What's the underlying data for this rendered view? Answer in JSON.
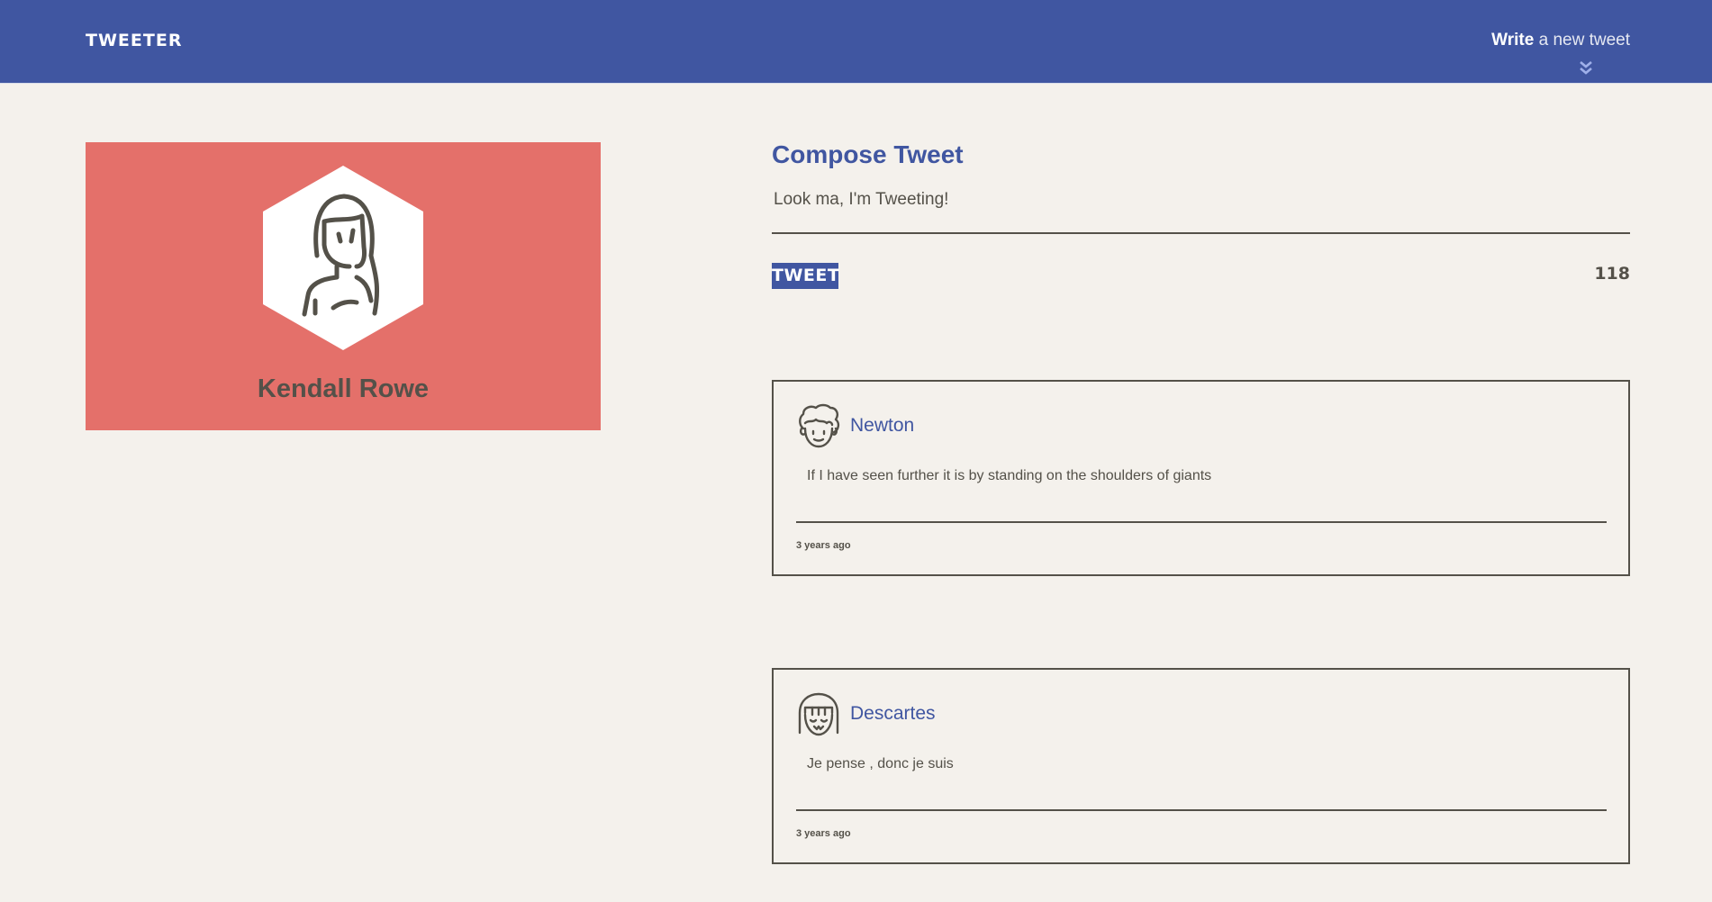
{
  "nav": {
    "brand": "TWEETER",
    "compose_toggle_strong": "Write",
    "compose_toggle_rest": " a new tweet",
    "chevron_icon": "double-chevron-down-icon"
  },
  "profile": {
    "name": "Kendall Rowe",
    "avatar_icon": "woman-avatar-icon",
    "card_color": "#e4706a"
  },
  "compose": {
    "title": "Compose Tweet",
    "input_value": "Look ma, I'm Tweeting!",
    "button_label": "TWEET",
    "counter": "118"
  },
  "tweets": [
    {
      "handle": "Newton",
      "content": "If I have seen further it is by standing on the shoulders of giants",
      "time": "3 years ago",
      "avatar_icon": "curly-hair-avatar-icon"
    },
    {
      "handle": "Descartes",
      "content": "Je pense , donc je suis",
      "time": "3 years ago",
      "avatar_icon": "bob-hair-avatar-icon"
    }
  ],
  "colors": {
    "accent": "#4056a1",
    "background": "#f4f1ec",
    "text": "#545149"
  }
}
